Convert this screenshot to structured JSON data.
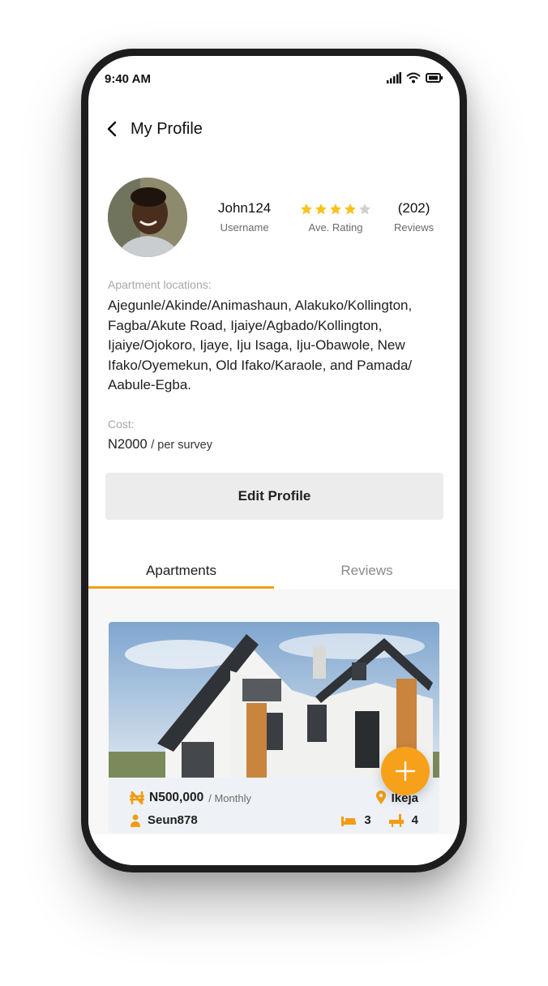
{
  "status_bar": {
    "time": "9:40 AM"
  },
  "header": {
    "title": "My Profile"
  },
  "profile": {
    "username": "John124",
    "username_label": "Username",
    "rating": 4,
    "rating_max": 5,
    "rating_label": "Ave. Rating",
    "reviews_count": "(202)",
    "reviews_label": "Reviews"
  },
  "locations": {
    "label": "Apartment locations:",
    "text": "Ajegunle/Akinde/Animashaun, Alakuko/Kollington, Fagba/Akute Road, Ijaiye/Agbado/Kollington, Ijaiye/Ojokoro, Ijaye, Iju Isaga, Iju-Obawole, New Ifako/Oyemekun, Old Ifako/Karaole, and Pamada/ Aabule-Egba."
  },
  "cost": {
    "label": "Cost:",
    "amount": "N2000",
    "unit": "/ per survey"
  },
  "edit_button": {
    "label": "Edit Profile"
  },
  "tabs": [
    {
      "label": "Apartments",
      "active": true
    },
    {
      "label": "Reviews",
      "active": false
    }
  ],
  "apartment_card": {
    "price": "N500,000",
    "period": "/ Monthly",
    "location": "Ikeja",
    "owner": "Seun878",
    "bedrooms": "3",
    "bathrooms": "4"
  },
  "colors": {
    "accent": "#f39c12",
    "fab": "#f7a01a",
    "star": "#f6c21c",
    "star_empty": "#d0d0d0"
  }
}
